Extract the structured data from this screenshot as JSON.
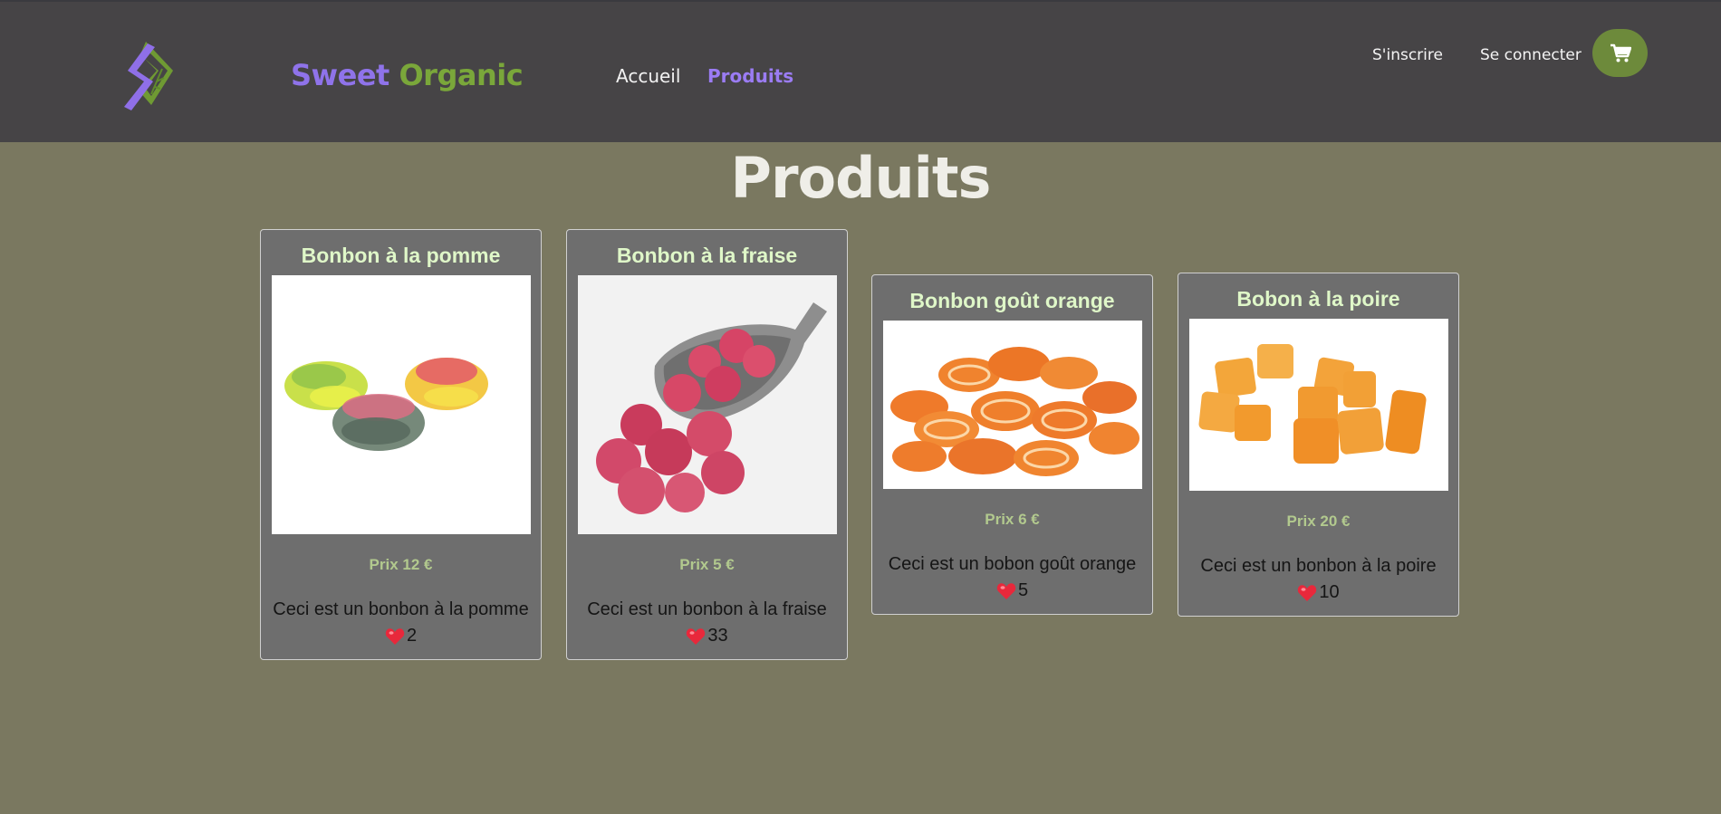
{
  "header": {
    "brand_part1": "Sweet",
    "brand_part2": "Organic",
    "nav": [
      {
        "label": "Accueil",
        "active": false
      },
      {
        "label": "Produits",
        "active": true
      }
    ],
    "signup_label": "S'inscrire",
    "login_label": "Se connecter",
    "cart_icon": "cart-icon"
  },
  "page": {
    "title": "Produits"
  },
  "products": [
    {
      "name": "Bonbon à la pomme",
      "price": "Prix 12 €",
      "description": "Ceci est un bonbon à la pomme",
      "likes": "2",
      "image": "sour-apple-candies"
    },
    {
      "name": "Bonbon à la fraise",
      "price": "Prix 5 €",
      "description": "Ceci est un bonbon à la fraise",
      "likes": "33",
      "image": "strawberry-candies-scoop"
    },
    {
      "name": "Bonbon goût orange",
      "price": "Prix 6 €",
      "description": "Ceci est un bobon goût orange",
      "likes": "5",
      "image": "orange-slice-candies"
    },
    {
      "name": "Bobon à la poire",
      "price": "Prix 20 €",
      "description": "Ceci est un bonbon à la poire",
      "likes": "10",
      "image": "pear-jelly-cubes"
    }
  ],
  "colors": {
    "header_bg": "#464446",
    "page_bg": "#7a7860",
    "brand_purple": "#8f73ea",
    "brand_green": "#7aa73a",
    "card_bg": "#6e6e6e",
    "card_title": "#dff7c8",
    "price": "#b2c98e",
    "cart_button": "#6d8a3b"
  }
}
